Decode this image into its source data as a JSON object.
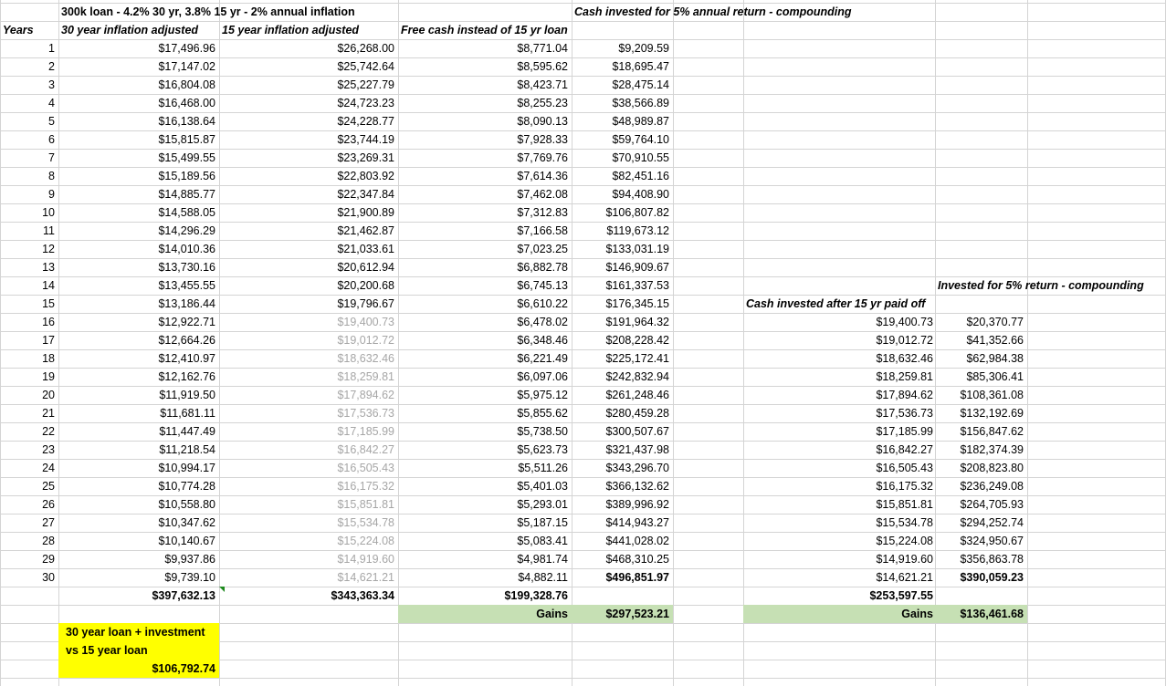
{
  "title": "300k loan - 4.2% 30 yr, 3.8% 15 yr - 2% annual inflation",
  "headers": {
    "years": "Years",
    "col_30yr": "30 year inflation adjusted",
    "col_15yr": "15 year inflation adjusted",
    "col_free": "Free cash instead of 15 yr loan",
    "col_invested": "Cash invested for 5% annual return - compounding",
    "col_after": "Cash invested after 15 yr paid off",
    "col_after_invested": "Invested for 5% return - compounding"
  },
  "rows": [
    {
      "year": "1",
      "a": "$17,496.96",
      "b": "$26,268.00",
      "c": "$8,771.04",
      "d": "$9,209.59"
    },
    {
      "year": "2",
      "a": "$17,147.02",
      "b": "$25,742.64",
      "c": "$8,595.62",
      "d": "$18,695.47"
    },
    {
      "year": "3",
      "a": "$16,804.08",
      "b": "$25,227.79",
      "c": "$8,423.71",
      "d": "$28,475.14"
    },
    {
      "year": "4",
      "a": "$16,468.00",
      "b": "$24,723.23",
      "c": "$8,255.23",
      "d": "$38,566.89"
    },
    {
      "year": "5",
      "a": "$16,138.64",
      "b": "$24,228.77",
      "c": "$8,090.13",
      "d": "$48,989.87"
    },
    {
      "year": "6",
      "a": "$15,815.87",
      "b": "$23,744.19",
      "c": "$7,928.33",
      "d": "$59,764.10"
    },
    {
      "year": "7",
      "a": "$15,499.55",
      "b": "$23,269.31",
      "c": "$7,769.76",
      "d": "$70,910.55"
    },
    {
      "year": "8",
      "a": "$15,189.56",
      "b": "$22,803.92",
      "c": "$7,614.36",
      "d": "$82,451.16"
    },
    {
      "year": "9",
      "a": "$14,885.77",
      "b": "$22,347.84",
      "c": "$7,462.08",
      "d": "$94,408.90"
    },
    {
      "year": "10",
      "a": "$14,588.05",
      "b": "$21,900.89",
      "c": "$7,312.83",
      "d": "$106,807.82"
    },
    {
      "year": "11",
      "a": "$14,296.29",
      "b": "$21,462.87",
      "c": "$7,166.58",
      "d": "$119,673.12"
    },
    {
      "year": "12",
      "a": "$14,010.36",
      "b": "$21,033.61",
      "c": "$7,023.25",
      "d": "$133,031.19"
    },
    {
      "year": "13",
      "a": "$13,730.16",
      "b": "$20,612.94",
      "c": "$6,882.78",
      "d": "$146,909.67"
    },
    {
      "year": "14",
      "a": "$13,455.55",
      "b": "$20,200.68",
      "c": "$6,745.13",
      "d": "$161,337.53"
    },
    {
      "year": "15",
      "a": "$13,186.44",
      "b": "$19,796.67",
      "c": "$6,610.22",
      "d": "$176,345.15"
    },
    {
      "year": "16",
      "a": "$12,922.71",
      "b": "$19,400.73",
      "c": "$6,478.02",
      "d": "$191,964.32",
      "e": "$19,400.73",
      "f": "$20,370.77"
    },
    {
      "year": "17",
      "a": "$12,664.26",
      "b": "$19,012.72",
      "c": "$6,348.46",
      "d": "$208,228.42",
      "e": "$19,012.72",
      "f": "$41,352.66"
    },
    {
      "year": "18",
      "a": "$12,410.97",
      "b": "$18,632.46",
      "c": "$6,221.49",
      "d": "$225,172.41",
      "e": "$18,632.46",
      "f": "$62,984.38"
    },
    {
      "year": "19",
      "a": "$12,162.76",
      "b": "$18,259.81",
      "c": "$6,097.06",
      "d": "$242,832.94",
      "e": "$18,259.81",
      "f": "$85,306.41"
    },
    {
      "year": "20",
      "a": "$11,919.50",
      "b": "$17,894.62",
      "c": "$5,975.12",
      "d": "$261,248.46",
      "e": "$17,894.62",
      "f": "$108,361.08"
    },
    {
      "year": "21",
      "a": "$11,681.11",
      "b": "$17,536.73",
      "c": "$5,855.62",
      "d": "$280,459.28",
      "e": "$17,536.73",
      "f": "$132,192.69"
    },
    {
      "year": "22",
      "a": "$11,447.49",
      "b": "$17,185.99",
      "c": "$5,738.50",
      "d": "$300,507.67",
      "e": "$17,185.99",
      "f": "$156,847.62"
    },
    {
      "year": "23",
      "a": "$11,218.54",
      "b": "$16,842.27",
      "c": "$5,623.73",
      "d": "$321,437.98",
      "e": "$16,842.27",
      "f": "$182,374.39"
    },
    {
      "year": "24",
      "a": "$10,994.17",
      "b": "$16,505.43",
      "c": "$5,511.26",
      "d": "$343,296.70",
      "e": "$16,505.43",
      "f": "$208,823.80"
    },
    {
      "year": "25",
      "a": "$10,774.28",
      "b": "$16,175.32",
      "c": "$5,401.03",
      "d": "$366,132.62",
      "e": "$16,175.32",
      "f": "$236,249.08"
    },
    {
      "year": "26",
      "a": "$10,558.80",
      "b": "$15,851.81",
      "c": "$5,293.01",
      "d": "$389,996.92",
      "e": "$15,851.81",
      "f": "$264,705.93"
    },
    {
      "year": "27",
      "a": "$10,347.62",
      "b": "$15,534.78",
      "c": "$5,187.15",
      "d": "$414,943.27",
      "e": "$15,534.78",
      "f": "$294,252.74"
    },
    {
      "year": "28",
      "a": "$10,140.67",
      "b": "$15,224.08",
      "c": "$5,083.41",
      "d": "$441,028.02",
      "e": "$15,224.08",
      "f": "$324,950.67"
    },
    {
      "year": "29",
      "a": "$9,937.86",
      "b": "$14,919.60",
      "c": "$4,981.74",
      "d": "$468,310.25",
      "e": "$14,919.60",
      "f": "$356,863.78"
    },
    {
      "year": "30",
      "a": "$9,739.10",
      "b": "$14,621.21",
      "c": "$4,882.11",
      "d": "$496,851.97",
      "e": "$14,621.21",
      "f": "$390,059.23"
    }
  ],
  "totals": {
    "a": "$397,632.13",
    "b": "$343,363.34",
    "c": "$199,328.76",
    "e": "$253,597.55"
  },
  "gains": {
    "label": "Gains",
    "left_value": "$297,523.21",
    "right_value": "$136,461.68"
  },
  "summary": {
    "line1": "30 year loan + investment",
    "line2": "vs 15 year loan",
    "value": "$106,792.74"
  },
  "colors": {
    "gains_fill": "#c6e0b4",
    "summary_fill": "#ffff00",
    "muted_text": "#a6a6a6",
    "grid": "#d4d4d4"
  }
}
